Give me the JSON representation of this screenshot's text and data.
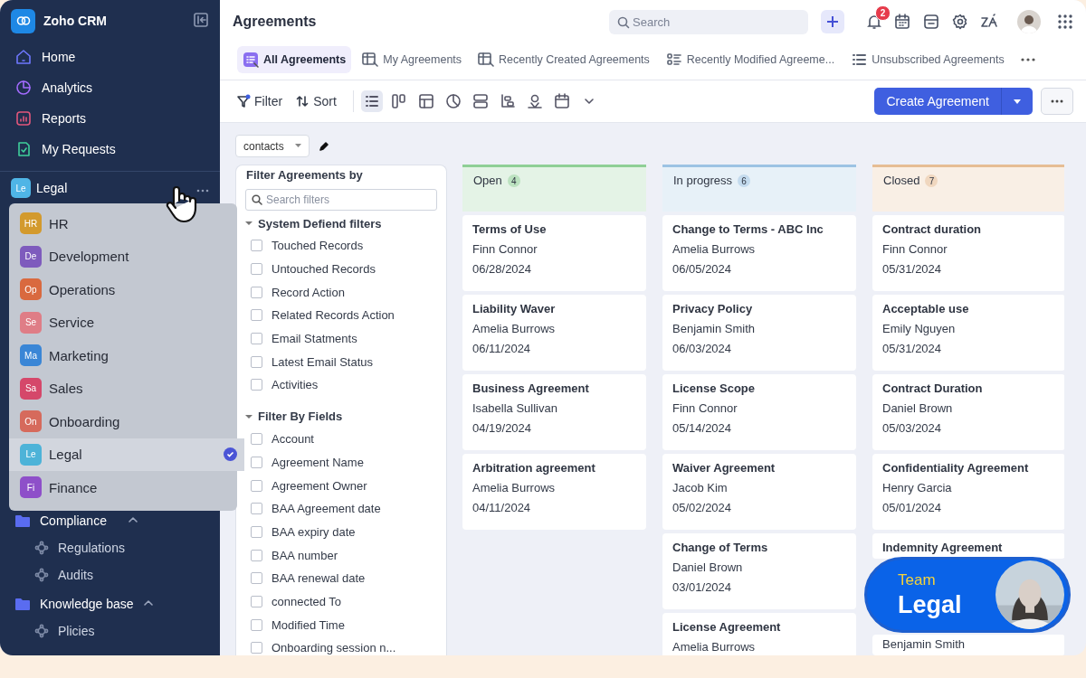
{
  "app": {
    "name": "Zoho CRM"
  },
  "sidebar": {
    "nav": [
      {
        "label": "Home"
      },
      {
        "label": "Analytics"
      },
      {
        "label": "Reports"
      },
      {
        "label": "My Requests"
      }
    ],
    "team": {
      "initials": "Le",
      "name": "Legal",
      "color": "#4fb5e6"
    },
    "team_menu": [
      {
        "initials": "HR",
        "name": "HR",
        "color": "#d39a2d",
        "selected": false
      },
      {
        "initials": "De",
        "name": "Development",
        "color": "#7e5bbd",
        "selected": false
      },
      {
        "initials": "Op",
        "name": "Operations",
        "color": "#d9693f",
        "selected": false
      },
      {
        "initials": "Se",
        "name": "Service",
        "color": "#df7d86",
        "selected": false
      },
      {
        "initials": "Ma",
        "name": "Marketing",
        "color": "#3a86d6",
        "selected": false
      },
      {
        "initials": "Sa",
        "name": "Sales",
        "color": "#d5476a",
        "selected": false
      },
      {
        "initials": "On",
        "name": "Onboarding",
        "color": "#d66a5c",
        "selected": false
      },
      {
        "initials": "Le",
        "name": "Legal",
        "color": "#4db3d8",
        "selected": true
      },
      {
        "initials": "Fi",
        "name": "Finance",
        "color": "#8e4fc9",
        "selected": false
      }
    ],
    "folders": [
      {
        "name": "Compliance",
        "expanded": true,
        "children": [
          {
            "label": "Regulations"
          },
          {
            "label": "Audits"
          }
        ]
      },
      {
        "name": "Knowledge base",
        "expanded": true,
        "children": [
          {
            "label": "Plicies"
          }
        ]
      }
    ]
  },
  "header": {
    "title": "Agreements",
    "search": {
      "placeholder": "Search"
    },
    "notifications": "2"
  },
  "tabs": [
    {
      "label": "All Agreements",
      "selected": true
    },
    {
      "label": "My Agreements",
      "selected": false
    },
    {
      "label": "Recently Created Agreements",
      "selected": false
    },
    {
      "label": "Recently Modified Agreeme...",
      "selected": false
    },
    {
      "label": "Unsubscribed Agreements",
      "selected": false
    }
  ],
  "toolbar": {
    "filter": "Filter",
    "sort": "Sort",
    "views": [
      {
        "selected": true
      },
      {
        "selected": false
      },
      {
        "selected": false
      },
      {
        "selected": false
      },
      {
        "selected": false
      },
      {
        "selected": false
      },
      {
        "selected": false
      },
      {
        "selected": false
      }
    ],
    "create": "Create Agreement"
  },
  "layout_select": {
    "value": "contacts"
  },
  "filter_panel": {
    "title": "Filter Agreements by",
    "search": {
      "placeholder": "Search filters"
    },
    "groups": [
      {
        "name": "System Defiend filters",
        "expanded": true,
        "items": [
          {
            "label": "Touched Records",
            "checked": false
          },
          {
            "label": "Untouched Records",
            "checked": false
          },
          {
            "label": "Record Action",
            "checked": false
          },
          {
            "label": "Related Records Action",
            "checked": false
          },
          {
            "label": "Email Statments",
            "checked": false
          },
          {
            "label": "Latest Email Status",
            "checked": false
          },
          {
            "label": "Activities",
            "checked": false
          }
        ]
      },
      {
        "name": "Filter By Fields",
        "expanded": true,
        "items": [
          {
            "label": "Account",
            "checked": false
          },
          {
            "label": "Agreement Name",
            "checked": false
          },
          {
            "label": "Agreement Owner",
            "checked": false
          },
          {
            "label": "BAA Agreement date",
            "checked": false
          },
          {
            "label": "BAA expiry date",
            "checked": false
          },
          {
            "label": "BAA number",
            "checked": false
          },
          {
            "label": "BAA renewal date",
            "checked": false
          },
          {
            "label": "connected To",
            "checked": false
          },
          {
            "label": "Modified Time",
            "checked": false
          },
          {
            "label": "Onboarding session n...",
            "checked": false
          }
        ]
      }
    ]
  },
  "board": {
    "columns": [
      {
        "name": "Open",
        "count": "4",
        "color": "#8fcf96",
        "cards": [
          {
            "title": "Terms of Use",
            "owner": "Finn Connor",
            "date": "06/28/2024"
          },
          {
            "title": "Liability Waver",
            "owner": "Amelia Burrows",
            "date": "06/11/2024"
          },
          {
            "title": "Business Agreement",
            "owner": "Isabella Sullivan",
            "date": "04/19/2024"
          },
          {
            "title": "Arbitration agreement",
            "owner": "Amelia Burrows",
            "date": "04/11/2024"
          }
        ]
      },
      {
        "name": "In progress",
        "count": "6",
        "color": "#9cc3e3",
        "cards": [
          {
            "title": "Change to Terms - ABC Inc",
            "owner": "Amelia Burrows",
            "date": "06/05/2024"
          },
          {
            "title": "Privacy Policy",
            "owner": "Benjamin Smith",
            "date": "06/03/2024"
          },
          {
            "title": "License Scope",
            "owner": "Finn Connor",
            "date": "05/14/2024"
          },
          {
            "title": "Waiver Agreement",
            "owner": "Jacob Kim",
            "date": "05/02/2024"
          },
          {
            "title": "Change of Terms",
            "owner": "Daniel Brown",
            "date": "03/01/2024"
          },
          {
            "title": "License Agreement",
            "owner": "Amelia Burrows"
          }
        ]
      },
      {
        "name": "Closed",
        "count": "7",
        "color": "#e6bd94",
        "cards": [
          {
            "title": "Contract duration",
            "owner": "Finn Connor",
            "date": "05/31/2024"
          },
          {
            "title": "Acceptable use",
            "owner": "Emily Nguyen",
            "date": "05/31/2024"
          },
          {
            "title": "Contract Duration",
            "owner": "Daniel Brown",
            "date": "05/03/2024"
          },
          {
            "title": "Confidentiality Agreement",
            "owner": "Henry Garcia",
            "date": "05/01/2024"
          },
          {
            "title": "Indemnity Agreement"
          },
          {
            "owner": "Benjamin Smith"
          }
        ]
      }
    ]
  },
  "team_badge": {
    "label": "Team",
    "name": "Legal"
  }
}
